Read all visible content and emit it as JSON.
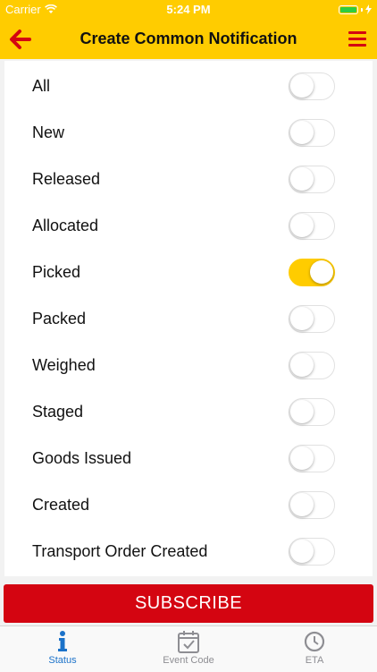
{
  "status_bar": {
    "carrier": "Carrier",
    "time": "5:24 PM"
  },
  "header": {
    "title": "Create Common Notification",
    "back_icon": "back-arrow-icon",
    "menu_icon": "hamburger-menu-icon"
  },
  "colors": {
    "accent": "#ffcc00",
    "brand_red": "#d40511",
    "tab_active": "#1b72c9"
  },
  "statuses": [
    {
      "label": "All",
      "on": false
    },
    {
      "label": "New",
      "on": false
    },
    {
      "label": "Released",
      "on": false
    },
    {
      "label": "Allocated",
      "on": false
    },
    {
      "label": "Picked",
      "on": true
    },
    {
      "label": "Packed",
      "on": false
    },
    {
      "label": "Weighed",
      "on": false
    },
    {
      "label": "Staged",
      "on": false
    },
    {
      "label": "Goods Issued",
      "on": false
    },
    {
      "label": "Created",
      "on": false
    },
    {
      "label": "Transport Order Created",
      "on": false
    }
  ],
  "subscribe_label": "SUBSCRIBE",
  "tabs": [
    {
      "label": "Status",
      "icon": "info-icon",
      "active": true
    },
    {
      "label": "Event Code",
      "icon": "calendar-check-icon",
      "active": false
    },
    {
      "label": "ETA",
      "icon": "clock-icon",
      "active": false
    }
  ]
}
